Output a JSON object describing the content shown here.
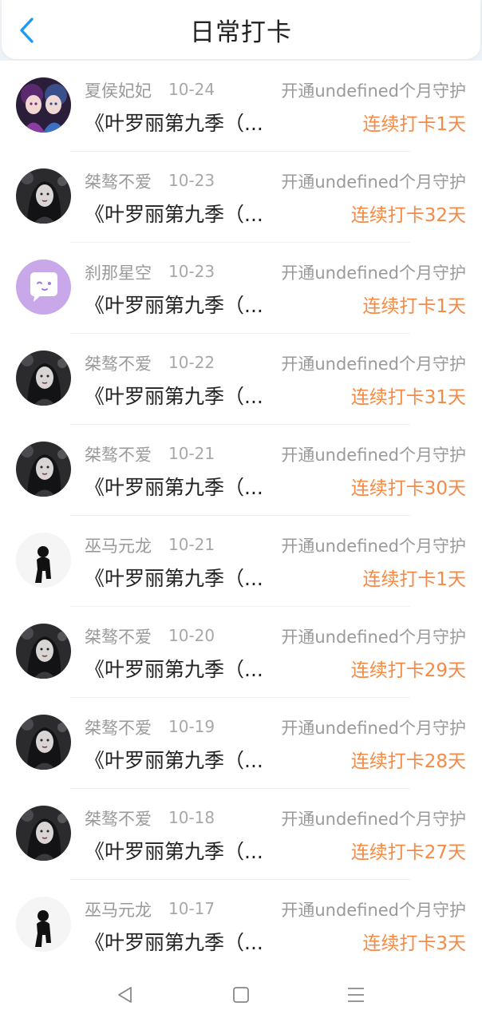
{
  "header": {
    "title": "日常打卡",
    "back_icon": "chevron-left-icon",
    "accent_color": "#1e9bf0"
  },
  "rows": [
    {
      "name": "夏侯妃妃",
      "date": "10-24",
      "guard": "开通undefined个月守护",
      "content": "《叶罗丽第九季（...",
      "streak": "连续打卡1天",
      "avatar": "girls-pair"
    },
    {
      "name": "桀骜不爱",
      "date": "10-23",
      "guard": "开通undefined个月守护",
      "content": "《叶罗丽第九季（...",
      "streak": "连续打卡32天",
      "avatar": "dark-girl"
    },
    {
      "name": "刹那星空",
      "date": "10-23",
      "guard": "开通undefined个月守护",
      "content": "《叶罗丽第九季（...",
      "streak": "连续打卡1天",
      "avatar": "chat-bubble"
    },
    {
      "name": "桀骜不爱",
      "date": "10-22",
      "guard": "开通undefined个月守护",
      "content": "《叶罗丽第九季（...",
      "streak": "连续打卡31天",
      "avatar": "dark-girl"
    },
    {
      "name": "桀骜不爱",
      "date": "10-21",
      "guard": "开通undefined个月守护",
      "content": "《叶罗丽第九季（...",
      "streak": "连续打卡30天",
      "avatar": "dark-girl"
    },
    {
      "name": "巫马元龙",
      "date": "10-21",
      "guard": "开通undefined个月守护",
      "content": "《叶罗丽第九季（...",
      "streak": "连续打卡1天",
      "avatar": "silhouette"
    },
    {
      "name": "桀骜不爱",
      "date": "10-20",
      "guard": "开通undefined个月守护",
      "content": "《叶罗丽第九季（...",
      "streak": "连续打卡29天",
      "avatar": "dark-girl"
    },
    {
      "name": "桀骜不爱",
      "date": "10-19",
      "guard": "开通undefined个月守护",
      "content": "《叶罗丽第九季（...",
      "streak": "连续打卡28天",
      "avatar": "dark-girl"
    },
    {
      "name": "桀骜不爱",
      "date": "10-18",
      "guard": "开通undefined个月守护",
      "content": "《叶罗丽第九季（...",
      "streak": "连续打卡27天",
      "avatar": "dark-girl"
    },
    {
      "name": "巫马元龙",
      "date": "10-17",
      "guard": "开通undefined个月守护",
      "content": "《叶罗丽第九季（...",
      "streak": "连续打卡3天",
      "avatar": "silhouette"
    }
  ],
  "colors": {
    "streak": "#f58a45",
    "meta": "#9a9a9a",
    "content": "#222222"
  },
  "navbar": {
    "back_icon": "triangle-back-icon",
    "home_icon": "square-home-icon",
    "menu_icon": "menu-lines-icon"
  }
}
